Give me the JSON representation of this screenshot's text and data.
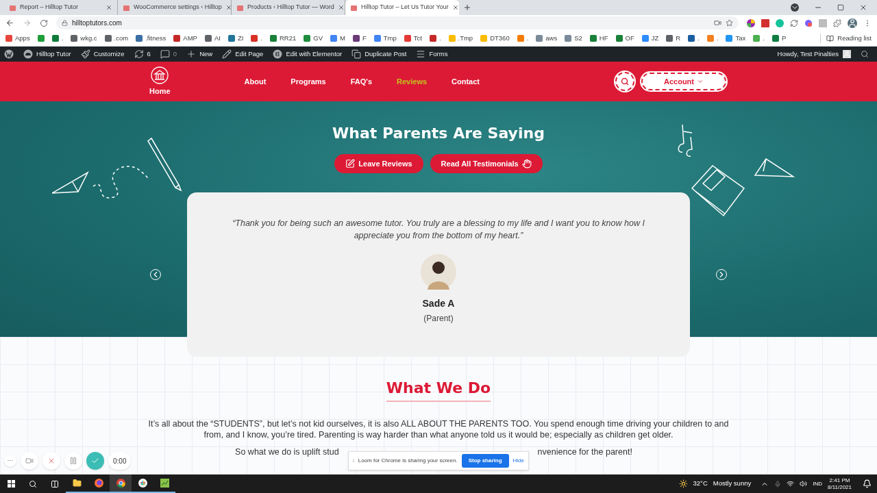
{
  "browser": {
    "tabs": [
      {
        "title": "Report – Hilltop Tutor",
        "selected": false
      },
      {
        "title": "WooCommerce settings ‹ Hilltop",
        "selected": false
      },
      {
        "title": "Products ‹ Hilltop Tutor — Word",
        "selected": false
      },
      {
        "title": "Hilltop Tutor – Let Us Tutor Your",
        "selected": true
      }
    ],
    "url": "hilltoptutors.com",
    "bookmarks": [
      {
        "label": "Apps",
        "color": "#e8453c"
      },
      {
        "color": "#1e9e3a"
      },
      {
        "label": ".",
        "color": "#0f7b3b"
      },
      {
        "label": "wkg.c",
        "color": "#5f6368"
      },
      {
        "label": ".com",
        "color": "#5f6368"
      },
      {
        "label": ".fitness",
        "color": "#3b6ea5"
      },
      {
        "label": "AMP",
        "color": "#c62828"
      },
      {
        "label": "AI",
        "color": "#5f6368"
      },
      {
        "label": "ZI",
        "color": "#21759b"
      },
      {
        "label": ".",
        "color": "#d93025"
      },
      {
        "label": "RR21",
        "color": "#188038"
      },
      {
        "label": "GV",
        "color": "#1e8e3e"
      },
      {
        "label": "M",
        "color": "#4285f4"
      },
      {
        "label": "F",
        "color": "#6b3b7a"
      },
      {
        "label": "Tmp",
        "color": "#4285f4"
      },
      {
        "label": "Tct",
        "color": "#e53935"
      },
      {
        "label": ".",
        "color": "#c62828"
      },
      {
        "label": ".Tmp",
        "color": "#fbbc04"
      },
      {
        "label": "DT360",
        "color": "#fbbc04"
      },
      {
        "label": ".",
        "color": "#f57c00"
      },
      {
        "label": "aws",
        "color": "#7a8a99"
      },
      {
        "label": "S2",
        "color": "#7a8a99"
      },
      {
        "label": "HF",
        "color": "#188038"
      },
      {
        "label": "OF",
        "color": "#188038"
      },
      {
        "label": "JZ",
        "color": "#2d8cff"
      },
      {
        "label": "R",
        "color": "#5f6368"
      },
      {
        "label": ".",
        "color": "#1a5fa0"
      },
      {
        "label": ".",
        "color": "#f48120"
      },
      {
        "label": "Tax",
        "color": "#2196f3"
      },
      {
        "label": ".",
        "color": "#4caf50"
      },
      {
        "label": "P",
        "color": "#107c41"
      }
    ],
    "reading_list": "Reading list"
  },
  "admin_bar": {
    "items": [
      {
        "kind": "site",
        "label": "Hilltop Tutor"
      },
      {
        "kind": "customize",
        "label": "Customize"
      },
      {
        "kind": "updates",
        "label": "6"
      },
      {
        "kind": "comments",
        "label": "0"
      },
      {
        "kind": "new",
        "label": "New"
      },
      {
        "kind": "edit",
        "label": "Edit Page"
      },
      {
        "kind": "elementor",
        "label": "Edit with Elementor"
      },
      {
        "kind": "duplicate",
        "label": "Duplicate Post"
      },
      {
        "kind": "forms",
        "label": "Forms"
      }
    ],
    "howdy": "Howdy, Test Pinalties"
  },
  "header": {
    "home": "Home",
    "nav": [
      {
        "label": "About",
        "selected": false
      },
      {
        "label": "Programs",
        "selected": false
      },
      {
        "label": "FAQ's",
        "selected": false
      },
      {
        "label": "Reviews",
        "selected": true
      },
      {
        "label": "Contact",
        "selected": false
      }
    ],
    "account": "Account"
  },
  "hero": {
    "title": "What Parents Are Saying",
    "buttons": [
      {
        "kind": "leave",
        "label": "Leave Reviews"
      },
      {
        "kind": "read",
        "label": "Read All Testimonials"
      }
    ],
    "testimonial": {
      "quote": "“Thank you for being such an awesome tutor. You truly are a blessing to my life and I want you to know how I appreciate you from the bottom of my heart.”",
      "name": "Sade A",
      "role": "(Parent)"
    }
  },
  "what_we_do": {
    "title": "What We Do",
    "paragraph": "It’s all about the “STUDENTS”, but let’s not kid ourselves, it is also ALL ABOUT THE PARENTS TOO. You spend enough time driving your children to and from, and I know, you’re tired. Parenting is way harder than what anyone told us it would be; especially as children get older.",
    "line_start": "So what we do is uplift stud",
    "line_end": "nvenience for the parent!"
  },
  "loom": {
    "menu": "···",
    "timer": "0:00",
    "message": "Loom for Chrome is sharing your screen.",
    "stop": "Stop sharing",
    "hide": "Hide"
  },
  "taskbar": {
    "temperature": "32°C",
    "weather": "Mostly sunny",
    "language": "IND",
    "time": "2:41 PM",
    "date": "8/11/2021"
  }
}
